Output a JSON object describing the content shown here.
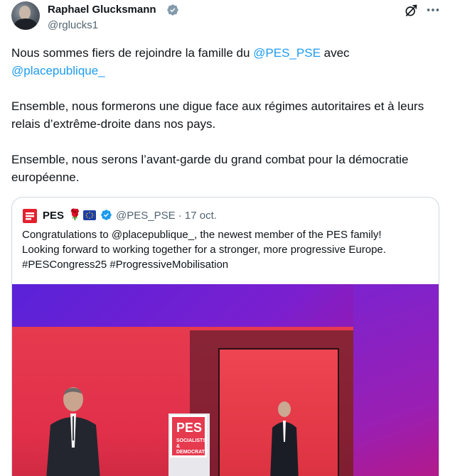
{
  "author": {
    "display_name": "Raphael Glucksmann",
    "handle": "@rglucks1"
  },
  "header_icons": [
    "grok-icon",
    "more-icon"
  ],
  "tweet": {
    "paragraphs": [
      {
        "before": "Nous sommes fiers de rejoindre la famille du ",
        "mention1": "@PES_PSE",
        "middle": " avec ",
        "mention2": "@placepublique_"
      },
      {
        "text": "Ensemble, nous formerons une digue face aux régimes autoritaires et à leurs relais d’extrême-droite dans nos pays."
      },
      {
        "text": "Ensemble, nous serons l’avant-garde du grand combat pour la démocratie européenne."
      }
    ]
  },
  "quoted": {
    "name": "PES",
    "emoji": "🌹",
    "handle_date": "@PES_PSE · 17 oct.",
    "text_lines": [
      "Congratulations to @placepublique_, the newest member of the PES family!",
      "Looking forward to working together for a stronger, more  progressive Europe.",
      "#PESCongress25 #ProgressiveMobilisation"
    ],
    "media": {
      "podium_sign_title": "PES",
      "podium_sign_sub": "SOCIALISTS & DEMOCRATS"
    }
  },
  "colors": {
    "link": "#1d9bf0",
    "verified": "#1d9bf0",
    "text_secondary": "#536471",
    "border": "#cfd9de"
  }
}
